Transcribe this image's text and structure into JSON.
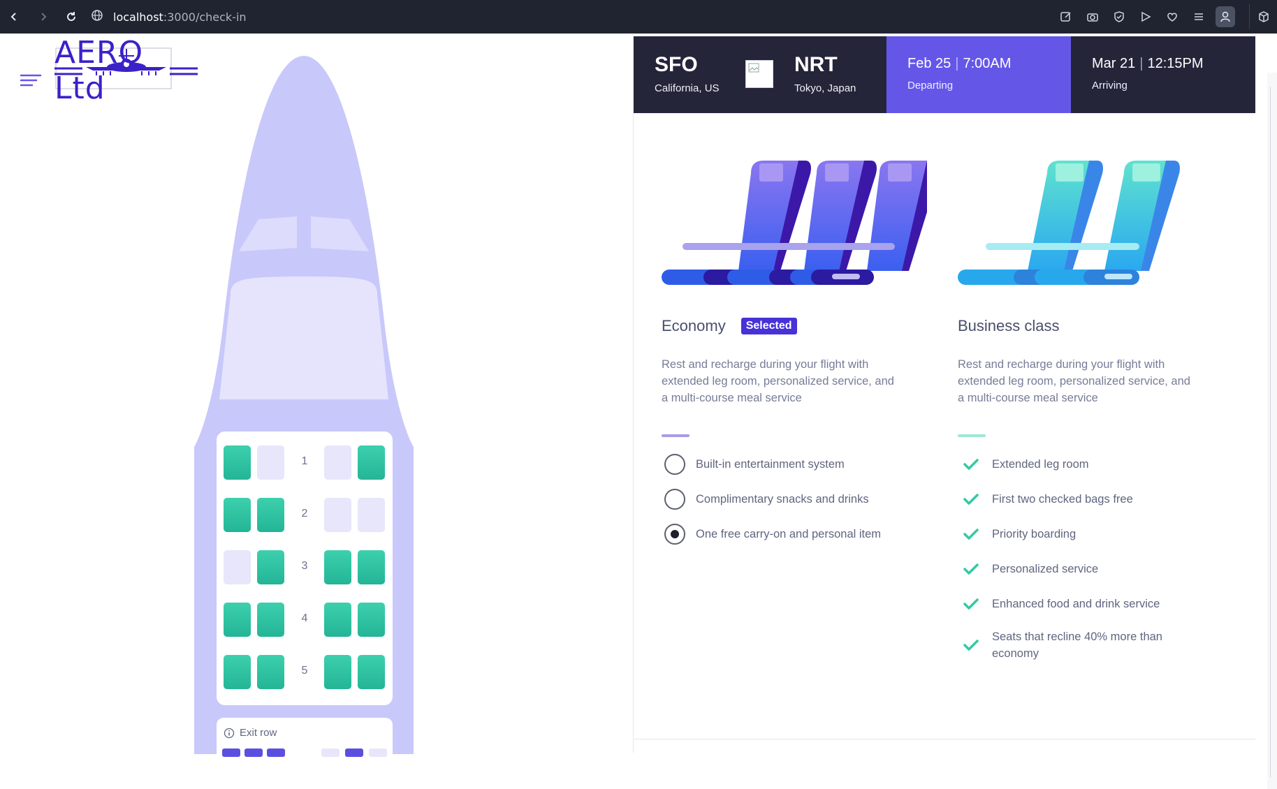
{
  "browser": {
    "url_host": "localhost",
    "url_rest": ":3000/check-in"
  },
  "brand": {
    "name": "AERO Ltd"
  },
  "seatmap": {
    "rows": [
      {
        "num": "1",
        "seats": [
          "taken",
          "free",
          "free",
          "taken"
        ]
      },
      {
        "num": "2",
        "seats": [
          "taken",
          "taken",
          "free",
          "free"
        ]
      },
      {
        "num": "3",
        "seats": [
          "free",
          "taken",
          "taken",
          "taken"
        ]
      },
      {
        "num": "4",
        "seats": [
          "taken",
          "taken",
          "taken",
          "taken"
        ]
      },
      {
        "num": "5",
        "seats": [
          "taken",
          "taken",
          "taken",
          "taken"
        ]
      }
    ],
    "exit_label": "Exit row"
  },
  "flight": {
    "from_code": "SFO",
    "from_city": "California, US",
    "to_code": "NRT",
    "to_city": "Tokyo, Japan",
    "depart_date": "Feb 25",
    "depart_time": "7:00AM",
    "depart_status": "Departing",
    "arrive_date": "Mar 21",
    "arrive_time": "12:15PM",
    "arrive_status": "Arriving"
  },
  "economy": {
    "name": "Economy",
    "badge": "Selected",
    "desc": "Rest and recharge during your flight with extended leg room, personalized service, and a multi-course meal service",
    "features": [
      {
        "label": "Built-in entertainment system",
        "selected": false
      },
      {
        "label": "Complimentary snacks and drinks",
        "selected": false
      },
      {
        "label": "One free carry-on and personal item",
        "selected": true
      }
    ]
  },
  "business": {
    "name": "Business class",
    "desc": "Rest and recharge during your flight with extended leg room, personalized service, and a multi-course meal service",
    "features": [
      {
        "label": "Extended leg room"
      },
      {
        "label": "First two checked bags free"
      },
      {
        "label": "Priority boarding"
      },
      {
        "label": "Personalized service"
      },
      {
        "label": "Enhanced food and drink service"
      },
      {
        "label": "Seats that recline 40% more than economy"
      }
    ]
  },
  "colors": {
    "accent": "#6457e8",
    "dark": "#25253a",
    "seat_taken": "#2bc29f",
    "seat_free": "#e7e6fb",
    "economy_bar": "#a99ae8",
    "business_bar": "#9ee7d4"
  }
}
